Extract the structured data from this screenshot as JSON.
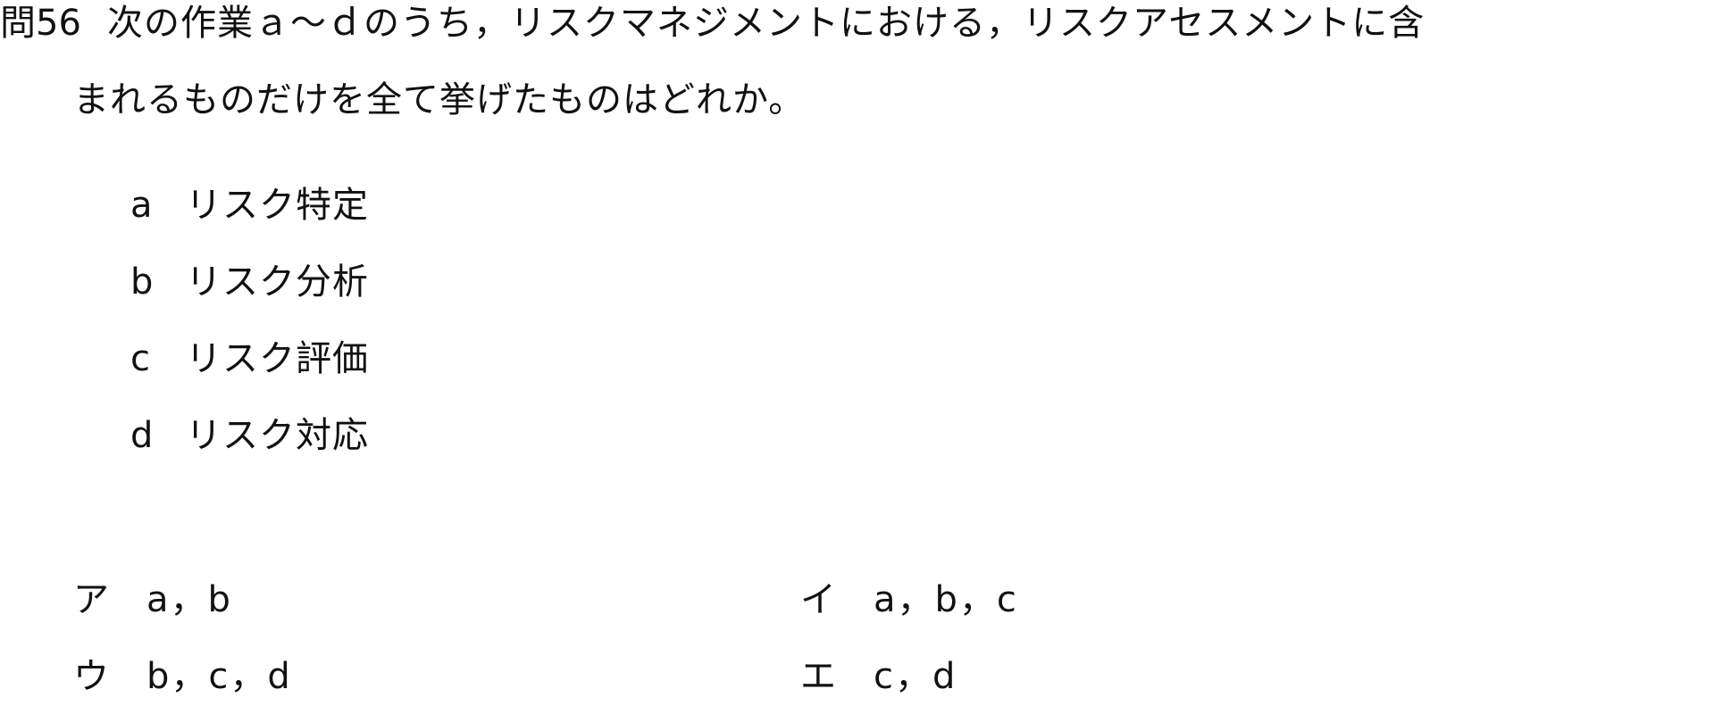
{
  "question": {
    "number": "問56",
    "text_line1": "次の作業ａ～ｄのうち，リスクマネジメントにおける，リスクアセスメントに含",
    "text_line2": "まれるものだけを全て挙げたものはどれか。"
  },
  "items": [
    {
      "letter": "a",
      "text": "リスク特定"
    },
    {
      "letter": "b",
      "text": "リスク分析"
    },
    {
      "letter": "c",
      "text": "リスク評価"
    },
    {
      "letter": "d",
      "text": "リスク対応"
    }
  ],
  "choices": [
    {
      "label": "ア",
      "value": "a，b"
    },
    {
      "label": "イ",
      "value": "a，b，c"
    },
    {
      "label": "ウ",
      "value": "b，c，d"
    },
    {
      "label": "エ",
      "value": "c，d"
    }
  ]
}
